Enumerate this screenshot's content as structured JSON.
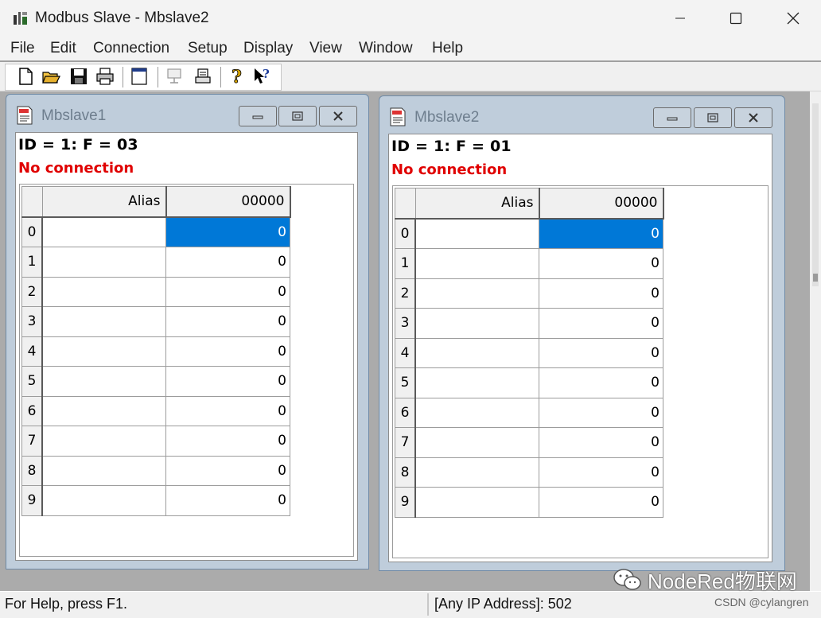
{
  "app": {
    "title": "Modbus Slave - Mbslave2"
  },
  "menu": [
    "File",
    "Edit",
    "Connection",
    "Setup",
    "Display",
    "View",
    "Window",
    "Help"
  ],
  "toolbar_icons": [
    "new-file-icon",
    "open-folder-icon",
    "save-icon",
    "print-icon",
    "window-icon",
    "connect-icon",
    "disconnect-icon",
    "help-icon",
    "context-help-icon"
  ],
  "windows": [
    {
      "title": "Mbslave1",
      "id_line": "ID = 1: F = 03",
      "status": "No connection",
      "columns": [
        "Alias",
        "00000"
      ],
      "rows": [
        {
          "idx": "0",
          "value": "0"
        },
        {
          "idx": "1",
          "value": "0"
        },
        {
          "idx": "2",
          "value": "0"
        },
        {
          "idx": "3",
          "value": "0"
        },
        {
          "idx": "4",
          "value": "0"
        },
        {
          "idx": "5",
          "value": "0"
        },
        {
          "idx": "6",
          "value": "0"
        },
        {
          "idx": "7",
          "value": "0"
        },
        {
          "idx": "8",
          "value": "0"
        },
        {
          "idx": "9",
          "value": "0"
        }
      ],
      "selected_row": 0
    },
    {
      "title": "Mbslave2",
      "id_line": "ID = 1: F = 01",
      "status": "No connection",
      "columns": [
        "Alias",
        "00000"
      ],
      "rows": [
        {
          "idx": "0",
          "value": "0"
        },
        {
          "idx": "1",
          "value": "0"
        },
        {
          "idx": "2",
          "value": "0"
        },
        {
          "idx": "3",
          "value": "0"
        },
        {
          "idx": "4",
          "value": "0"
        },
        {
          "idx": "5",
          "value": "0"
        },
        {
          "idx": "6",
          "value": "0"
        },
        {
          "idx": "7",
          "value": "0"
        },
        {
          "idx": "8",
          "value": "0"
        },
        {
          "idx": "9",
          "value": "0"
        }
      ],
      "selected_row": 0
    }
  ],
  "statusbar": {
    "help": "For Help, press F1.",
    "address": "[Any IP Address]: 502"
  },
  "watermark": {
    "text": "NodeRed物联网",
    "source": "CSDN @cylangren"
  },
  "colors": {
    "selection": "#0078d7",
    "error_text": "#e00000",
    "mdi_background": "#ababab",
    "child_frame": "#bfcddb"
  }
}
